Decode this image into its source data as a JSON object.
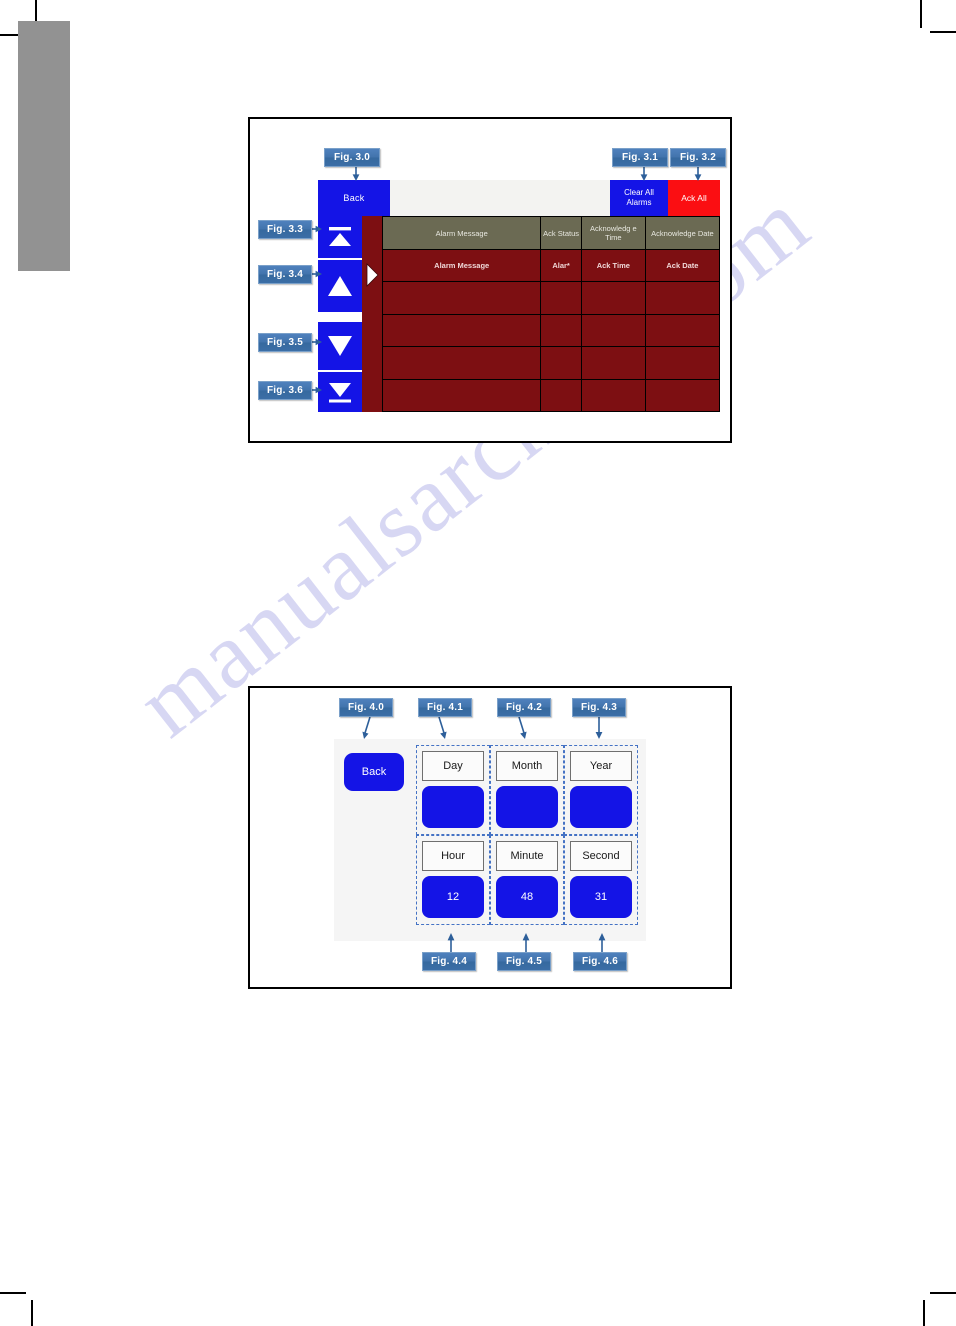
{
  "page": {
    "watermark_text": "manualsarchive.com"
  },
  "figure_alarm": {
    "toolbar": {
      "back_label": "Back",
      "clear_all_label": "Clear All Alarms",
      "ack_all_label": "Ack All"
    },
    "scroll_buttons": [
      {
        "name": "scroll-to-top",
        "icon": "triangle-up-with-bar-icon"
      },
      {
        "name": "scroll-up",
        "icon": "triangle-up-icon"
      },
      {
        "name": "scroll-down",
        "icon": "triangle-down-icon"
      },
      {
        "name": "scroll-to-bottom",
        "icon": "triangle-down-with-bar-icon"
      }
    ],
    "row_marker_icon": "triangle-right-icon",
    "table": {
      "headers": [
        "Alarm Message",
        "Ack Status",
        "Acknowledg e Time",
        "Acknowledge Date"
      ],
      "rows": [
        [
          "Alarm Message",
          "Alar*",
          "Ack Time",
          "Ack Date"
        ],
        [
          "",
          "",
          "",
          ""
        ],
        [
          "",
          "",
          "",
          ""
        ],
        [
          "",
          "",
          "",
          ""
        ],
        [
          "",
          "",
          "",
          ""
        ]
      ]
    },
    "callouts": [
      {
        "id": "fig-3-0",
        "label": "Fig. 3.0"
      },
      {
        "id": "fig-3-1",
        "label": "Fig. 3.1"
      },
      {
        "id": "fig-3-2",
        "label": "Fig. 3.2"
      },
      {
        "id": "fig-3-3",
        "label": "Fig. 3.3"
      },
      {
        "id": "fig-3-4",
        "label": "Fig. 3.4"
      },
      {
        "id": "fig-3-5",
        "label": "Fig. 3.5"
      },
      {
        "id": "fig-3-6",
        "label": "Fig. 3.6"
      }
    ]
  },
  "figure_datetime": {
    "back_label": "Back",
    "fields": [
      {
        "label": "Day",
        "value": ""
      },
      {
        "label": "Month",
        "value": ""
      },
      {
        "label": "Year",
        "value": ""
      },
      {
        "label": "Hour",
        "value": "12"
      },
      {
        "label": "Minute",
        "value": "48"
      },
      {
        "label": "Second",
        "value": "31"
      }
    ],
    "callouts": [
      {
        "id": "fig-4-0",
        "label": "Fig. 4.0"
      },
      {
        "id": "fig-4-1",
        "label": "Fig. 4.1"
      },
      {
        "id": "fig-4-2",
        "label": "Fig. 4.2"
      },
      {
        "id": "fig-4-3",
        "label": "Fig. 4.3"
      },
      {
        "id": "fig-4-4",
        "label": "Fig. 4.4"
      },
      {
        "id": "fig-4-5",
        "label": "Fig. 4.5"
      },
      {
        "id": "fig-4-6",
        "label": "Fig. 4.6"
      }
    ]
  },
  "colors": {
    "button_blue": "#1414e6",
    "alert_red": "#fb0e12",
    "table_body_red": "#7d0f12",
    "header_olive": "#6b6a53",
    "callout_blue": "#4f81bd",
    "page_tab_gray": "#929292"
  }
}
